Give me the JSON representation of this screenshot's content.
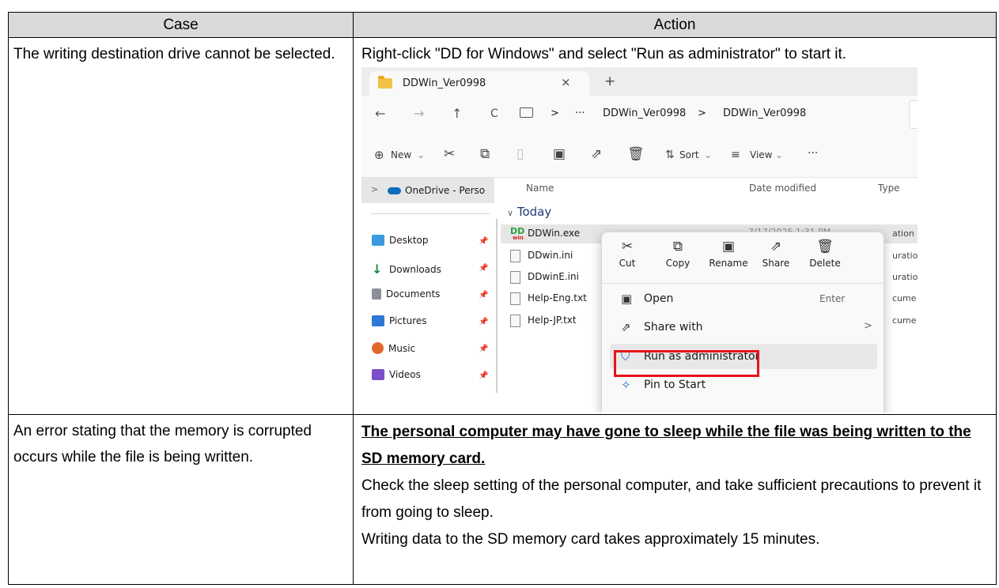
{
  "table": {
    "header": {
      "case": "Case",
      "action": "Action"
    },
    "rows": [
      {
        "case": "The writing destination drive cannot be selected.",
        "action": "Right-click \"DD for Windows\" and select \"Run as administrator\" to start it."
      },
      {
        "case": "An error stating that the memory is corrupted occurs while the file is being written.",
        "action_bold": "The personal computer may have gone to sleep while the file was being written to the SD memory card.",
        "action_lines": [
          "Check the sleep setting of the personal computer, and take sufficient precautions to prevent it from going to sleep.",
          "Writing data to the SD memory card takes approximately 15 minutes."
        ]
      }
    ]
  },
  "explorer": {
    "tab_title": "DDWin_Ver0998",
    "tab_close": "×",
    "new_tab": "+",
    "nav": {
      "back": "←",
      "forward": "→",
      "up": "↑",
      "refresh": "C"
    },
    "breadcrumb": {
      "sep": ">",
      "more": "···",
      "items": [
        "DDWin_Ver0998",
        "DDWin_Ver0998"
      ]
    },
    "toolbar": {
      "new_label": "New",
      "sort_label": "Sort",
      "view_label": "View",
      "more": "···",
      "chevron": "⌄"
    },
    "navpane": {
      "onedrive": "OneDrive - Perso",
      "expand": ">",
      "items": [
        {
          "label": "Desktop",
          "icon": "desktop-icon",
          "color": "#3a9be0"
        },
        {
          "label": "Downloads",
          "icon": "download-icon",
          "color": "#1c8a3f"
        },
        {
          "label": "Documents",
          "icon": "document-icon",
          "color": "#8a8f98"
        },
        {
          "label": "Pictures",
          "icon": "pictures-icon",
          "color": "#2e78d6"
        },
        {
          "label": "Music",
          "icon": "music-icon",
          "color": "#e0662c"
        },
        {
          "label": "Videos",
          "icon": "videos-icon",
          "color": "#7a4fc9"
        }
      ]
    },
    "columns": {
      "name": "Name",
      "date": "Date modified",
      "type": "Type"
    },
    "group": "Today",
    "files": [
      {
        "name": "DDWin.exe",
        "type": "ation"
      },
      {
        "name": "DDwin.ini",
        "type": "uratio"
      },
      {
        "name": "DDwinE.ini",
        "type": "uratio"
      },
      {
        "name": "Help-Eng.txt",
        "type": "cume"
      },
      {
        "name": "Help-JP.txt",
        "type": "cume"
      }
    ],
    "exe_date": "7/17/2025 1:31 PM",
    "context_menu": {
      "quick_actions": [
        {
          "label": "Cut",
          "icon": "cut-icon"
        },
        {
          "label": "Copy",
          "icon": "copy-icon"
        },
        {
          "label": "Rename",
          "icon": "rename-icon"
        },
        {
          "label": "Share",
          "icon": "share-icon"
        },
        {
          "label": "Delete",
          "icon": "delete-icon"
        }
      ],
      "items": [
        {
          "label": "Open",
          "shortcut": "Enter"
        },
        {
          "label": "Share with",
          "submenu": ">"
        },
        {
          "label": "Run as administrator",
          "highlight": "#e8121a"
        },
        {
          "label": "Pin to Start"
        }
      ]
    }
  }
}
